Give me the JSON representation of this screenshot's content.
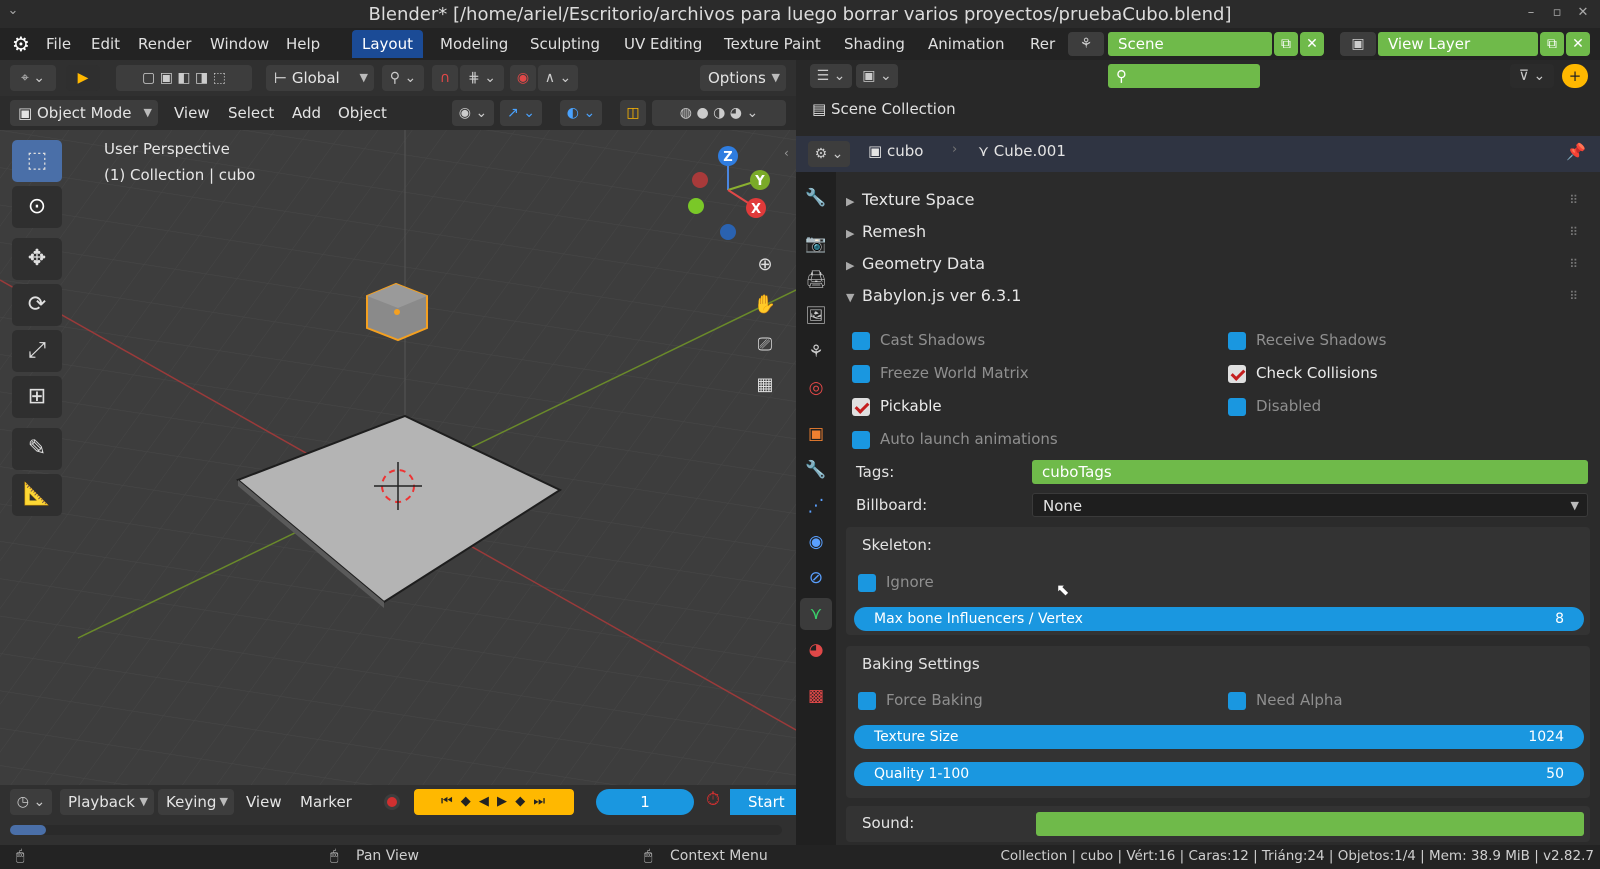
{
  "window": {
    "title": "Blender* [/home/ariel/Escritorio/archivos para luego borrar varios proyectos/pruebaCubo.blend]"
  },
  "menu": [
    "File",
    "Edit",
    "Render",
    "Window",
    "Help"
  ],
  "workspaces": [
    "Layout",
    "Modeling",
    "Sculpting",
    "UV Editing",
    "Texture Paint",
    "Shading",
    "Animation",
    "Rer"
  ],
  "active_workspace": "Layout",
  "scene": {
    "name": "Scene",
    "view_layer": "View Layer"
  },
  "viewport_header": {
    "transform": "Global",
    "options": "Options",
    "mode": "Object Mode",
    "menus": [
      "View",
      "Select",
      "Add",
      "Object"
    ]
  },
  "viewport": {
    "perspective": "User Perspective",
    "collection_info": "(1) Collection | cubo",
    "gizmo": {
      "x": "X",
      "y": "Y",
      "z": "Z"
    }
  },
  "timeline": {
    "playback": "Playback",
    "keying": "Keying",
    "view": "View",
    "marker": "Marker",
    "frame": "1",
    "start": "Start"
  },
  "outliner": {
    "root": "Scene Collection"
  },
  "properties": {
    "breadcrumb_object": "cubo",
    "breadcrumb_mesh": "Cube.001",
    "panels": [
      "Texture Space",
      "Remesh",
      "Geometry Data"
    ],
    "babylon_panel": "Babylon.js ver 6.3.1",
    "checkboxes": {
      "cast_shadows": "Cast Shadows",
      "receive_shadows": "Receive Shadows",
      "freeze_world_matrix": "Freeze World Matrix",
      "check_collisions": "Check Collisions",
      "pickable": "Pickable",
      "disabled": "Disabled",
      "auto_launch": "Auto launch animations"
    },
    "tags_label": "Tags:",
    "tags_value": "cuboTags",
    "billboard_label": "Billboard:",
    "billboard_value": "None",
    "skeleton": {
      "title": "Skeleton:",
      "ignore": "Ignore",
      "max_bone_label": "Max bone Influencers / Vertex",
      "max_bone_value": "8"
    },
    "baking": {
      "title": "Baking Settings",
      "force_baking": "Force Baking",
      "need_alpha": "Need Alpha",
      "texture_size_label": "Texture Size",
      "texture_size_value": "1024",
      "quality_label": "Quality 1-100",
      "quality_value": "50"
    },
    "sound_label": "Sound:"
  },
  "statusbar": {
    "pan": "Pan View",
    "context": "Context Menu",
    "stats": "Collection | cubo | Vért:16 | Caras:12 | Triáng:24 | Objetos:1/4 | Mem: 38.9 MiB | v2.82.7"
  },
  "colors": {
    "accent_blue": "#1a97e0",
    "active_tab": "#1b4b96",
    "field_green": "#6fba4a"
  }
}
